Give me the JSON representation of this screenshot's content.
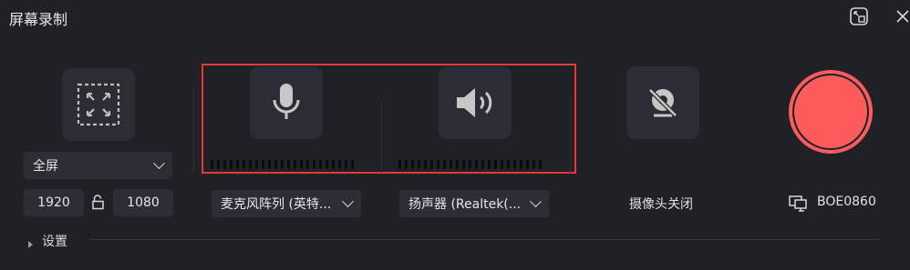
{
  "window": {
    "title": "屏幕录制"
  },
  "fullscreen": {
    "region_value": "全屏",
    "width": "1920",
    "height": "1080"
  },
  "microphone": {
    "device": "麦克风阵列 (英特..."
  },
  "speaker": {
    "device": "扬声器 (Realtek(..."
  },
  "camera": {
    "status": "摄像头关闭"
  },
  "monitor": {
    "name": "BOE0860"
  },
  "settings": {
    "label": "设置"
  },
  "colors": {
    "background": "#1f2126",
    "tile": "#2a2d33",
    "record": "#fb5c5c",
    "highlight": "#e53935"
  },
  "icons": [
    "pip-icon",
    "close-icon",
    "fullscreen-region-icon",
    "microphone-icon",
    "speaker-icon",
    "camera-off-icon",
    "record-icon",
    "lock-ratio-icon",
    "monitor-icon",
    "caret-right-icon",
    "chevron-down-icon"
  ]
}
